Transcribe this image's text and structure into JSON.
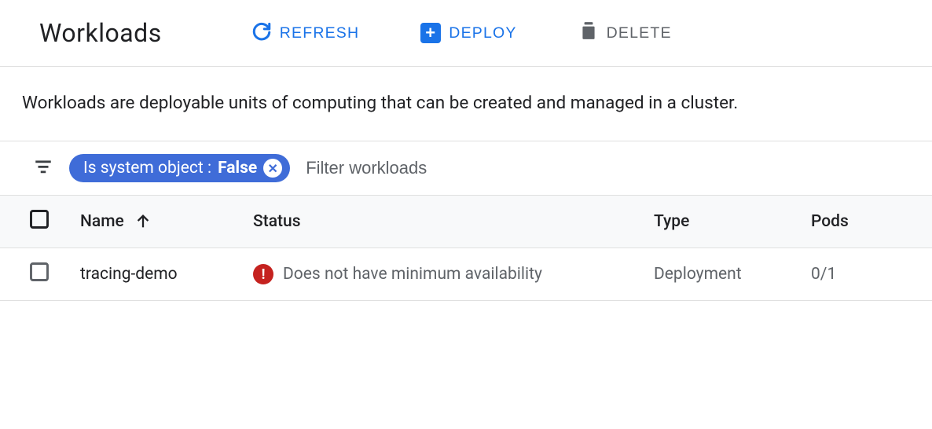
{
  "header": {
    "title": "Workloads",
    "refresh_label": "REFRESH",
    "deploy_label": "DEPLOY",
    "delete_label": "DELETE"
  },
  "description": "Workloads are deployable units of computing that can be created and managed in a cluster.",
  "filter": {
    "chip_key": "Is system object : ",
    "chip_value": "False",
    "placeholder": "Filter workloads"
  },
  "table": {
    "columns": {
      "name": "Name",
      "status": "Status",
      "type": "Type",
      "pods": "Pods"
    },
    "rows": [
      {
        "name": "tracing-demo",
        "status_text": "Does not have minimum availability",
        "status_level": "error",
        "type": "Deployment",
        "pods": "0/1"
      }
    ]
  }
}
